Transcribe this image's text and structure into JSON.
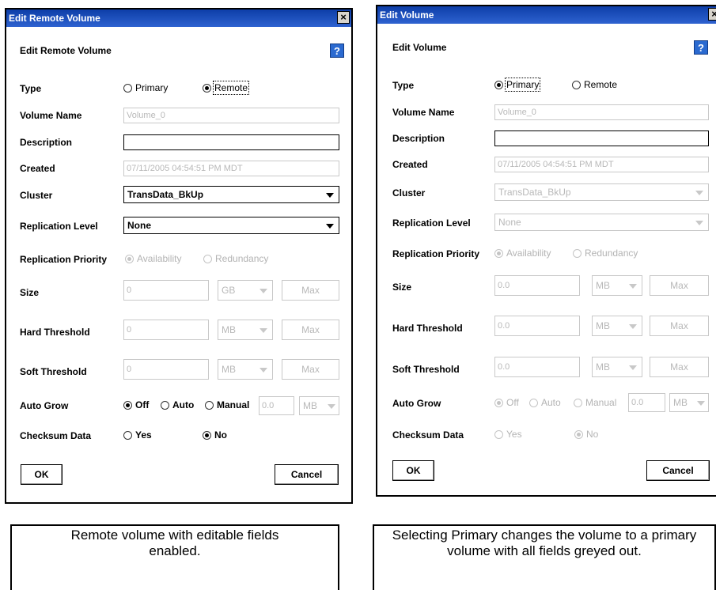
{
  "left": {
    "title": "Edit Remote Volume",
    "close_glyph": "×",
    "heading": "Edit Remote Volume",
    "help_glyph": "?",
    "labels": {
      "type": "Type",
      "volume_name": "Volume Name",
      "description": "Description",
      "created": "Created",
      "cluster": "Cluster",
      "replication_level": "Replication Level",
      "replication_priority": "Replication Priority",
      "size": "Size",
      "hard_threshold": "Hard Threshold",
      "soft_threshold": "Soft Threshold",
      "auto_grow": "Auto Grow",
      "checksum_data": "Checksum Data"
    },
    "type_options": {
      "primary": "Primary",
      "remote": "Remote",
      "selected": "Remote"
    },
    "volume_name": "Volume_0",
    "description": "",
    "created": "07/11/2005 04:54:51 PM MDT",
    "cluster": "TransData_BkUp",
    "replication_level": "None",
    "priority_options": {
      "availability": "Availability",
      "redundancy": "Redundancy",
      "selected": "Availability"
    },
    "size": {
      "value": "0",
      "unit": "GB",
      "max": "Max"
    },
    "hard_threshold": {
      "value": "0",
      "unit": "MB",
      "max": "Max"
    },
    "soft_threshold": {
      "value": "0",
      "unit": "MB",
      "max": "Max"
    },
    "auto_grow": {
      "off": "Off",
      "auto": "Auto",
      "manual": "Manual",
      "selected": "Off",
      "value": "0.0",
      "unit": "MB"
    },
    "checksum": {
      "yes": "Yes",
      "no": "No",
      "selected": "No"
    },
    "ok": "OK",
    "cancel": "Cancel"
  },
  "right": {
    "title": "Edit Volume",
    "close_glyph": "×",
    "heading": "Edit Volume",
    "help_glyph": "?",
    "labels": {
      "type": "Type",
      "volume_name": "Volume Name",
      "description": "Description",
      "created": "Created",
      "cluster": "Cluster",
      "replication_level": "Replication Level",
      "replication_priority": "Replication Priority",
      "size": "Size",
      "hard_threshold": "Hard Threshold",
      "soft_threshold": "Soft Threshold",
      "auto_grow": "Auto Grow",
      "checksum_data": "Checksum Data"
    },
    "type_options": {
      "primary": "Primary",
      "remote": "Remote",
      "selected": "Primary"
    },
    "volume_name": "Volume_0",
    "description": "",
    "created": "07/11/2005 04:54:51 PM MDT",
    "cluster": "TransData_BkUp",
    "replication_level": "None",
    "priority_options": {
      "availability": "Availability",
      "redundancy": "Redundancy",
      "selected": "Availability"
    },
    "size": {
      "value": "0.0",
      "unit": "MB",
      "max": "Max"
    },
    "hard_threshold": {
      "value": "0.0",
      "unit": "MB",
      "max": "Max"
    },
    "soft_threshold": {
      "value": "0.0",
      "unit": "MB",
      "max": "Max"
    },
    "auto_grow": {
      "off": "Off",
      "auto": "Auto",
      "manual": "Manual",
      "selected": "Off",
      "value": "0.0",
      "unit": "MB"
    },
    "checksum": {
      "yes": "Yes",
      "no": "No",
      "selected": "No"
    },
    "ok": "OK",
    "cancel": "Cancel"
  },
  "captions": {
    "left": "Remote volume with editable fields enabled.",
    "right": "Selecting Primary changes the volume to a primary volume with all fields greyed out."
  }
}
